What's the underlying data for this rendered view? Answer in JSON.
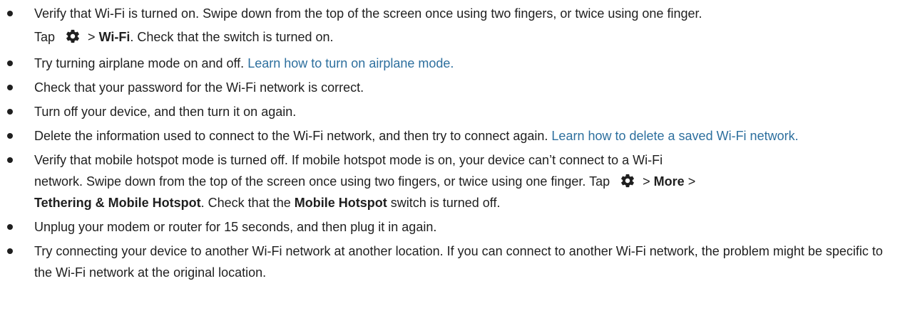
{
  "items": [
    {
      "line1": "Verify that Wi-Fi is turned on. Swipe down from the top of the screen once using two fingers, or twice using one finger.",
      "tap_prefix": "Tap",
      "arrow": ">",
      "wifi_label": "Wi-Fi",
      "suffix": ". Check that the switch is turned on."
    },
    {
      "text": "Try turning airplane mode on and off.",
      "link": "Learn how to turn on airplane mode."
    },
    {
      "text": "Check that your password for the Wi-Fi network is correct."
    },
    {
      "text": "Turn off your device, and then turn it on again."
    },
    {
      "text": "Delete the information used to connect to the Wi-Fi network, and then try to connect again.",
      "link": "Learn how to delete a saved Wi-Fi network."
    },
    {
      "line1": "Verify that mobile hotspot mode is turned off. If mobile hotspot mode is on, your device can’t connect to a Wi-Fi",
      "line2": "network. Swipe down from the top of the screen once using two fingers, or twice using one finger. Tap",
      "arrow1": ">",
      "more_label": "More",
      "arrow2": ">",
      "tethering_label": "Tethering & Mobile Hotspot",
      "mid": ". Check that the",
      "mobile_hotspot_label": "Mobile Hotspot",
      "suffix": "switch is turned off."
    },
    {
      "text": "Unplug your modem or router for 15 seconds, and then plug it in again."
    },
    {
      "text": "Try connecting your device to another Wi-Fi network at another location. If you can connect to another Wi-Fi network, the problem might be specific to the Wi-Fi network at the original location."
    }
  ],
  "icons": {
    "settings": "gear-icon"
  },
  "colors": {
    "text": "#1f1f1f",
    "link": "#2d6f9e"
  }
}
